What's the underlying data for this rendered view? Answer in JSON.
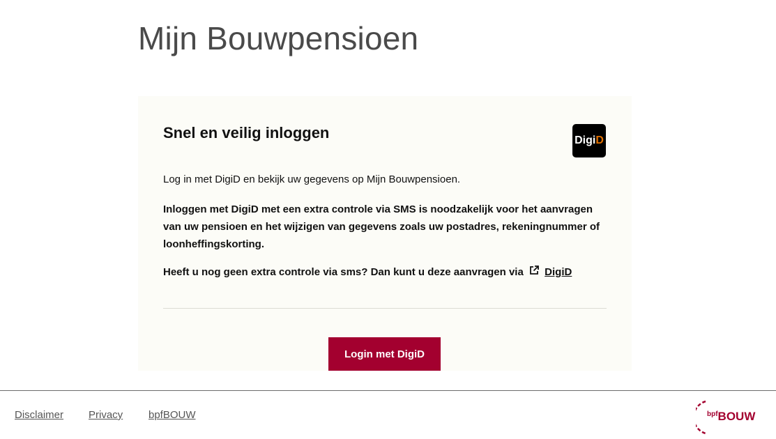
{
  "page": {
    "title": "Mijn Bouwpensioen"
  },
  "card": {
    "heading": "Snel en veilig inloggen",
    "logo": {
      "name": "digid-logo",
      "text_main": "Digi",
      "text_accent": "D",
      "bg": "#000000",
      "accent": "#e17000"
    },
    "intro": "Log in met DigiD en bekijk uw gegevens op Mijn Bouwpensioen.",
    "requirement": "Inloggen met DigiD met een extra controle via SMS is noodzakelijk voor het aanvragen van uw pensioen en het wijzigen van gegevens zoals uw postadres, rekeningnummer of loonheffingskorting.",
    "sms_text": "Heeft u nog geen extra controle via sms? Dan kunt u deze aanvragen via",
    "sms_link_icon": "external-link-icon",
    "sms_link": "DigiD",
    "login_button": "Login met DigiD"
  },
  "footer": {
    "links": [
      "Disclaimer",
      "Privacy",
      "bpfBOUW"
    ],
    "brand": {
      "small": "bpf",
      "big": "BOUW",
      "color": "#a3002f"
    }
  },
  "colors": {
    "primary": "#a3002f",
    "card_bg": "#fcfcf7",
    "title": "#4a4a4a"
  }
}
